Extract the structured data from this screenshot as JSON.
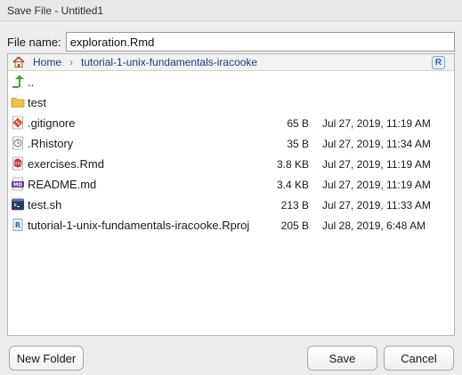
{
  "window": {
    "title": "Save File - Untitled1"
  },
  "filename": {
    "label": "File name:",
    "value": "exploration.Rmd"
  },
  "breadcrumb": {
    "home_label": "Home",
    "path_label": "tutorial-1-unix-fundamentals-iracooke",
    "project_badge": "R"
  },
  "files": [
    {
      "name": "..",
      "size": "",
      "modified": "",
      "icon": "parent-folder-icon"
    },
    {
      "name": "test",
      "size": "",
      "modified": "",
      "icon": "folder-icon"
    },
    {
      "name": ".gitignore",
      "size": "65 B",
      "modified": "Jul 27, 2019, 11:19 AM",
      "icon": "gitignore-icon"
    },
    {
      "name": ".Rhistory",
      "size": "35 B",
      "modified": "Jul 27, 2019, 11:34 AM",
      "icon": "history-icon"
    },
    {
      "name": "exercises.Rmd",
      "size": "3.8 KB",
      "modified": "Jul 27, 2019, 11:19 AM",
      "icon": "rmd-file-icon"
    },
    {
      "name": "README.md",
      "size": "3.4 KB",
      "modified": "Jul 27, 2019, 11:19 AM",
      "icon": "markdown-file-icon"
    },
    {
      "name": "test.sh",
      "size": "213 B",
      "modified": "Jul 27, 2019, 11:33 AM",
      "icon": "shell-script-icon"
    },
    {
      "name": "tutorial-1-unix-fundamentals-iracooke.Rproj",
      "size": "205 B",
      "modified": "Jul 28, 2019, 6:48 AM",
      "icon": "rproj-file-icon"
    }
  ],
  "buttons": {
    "new_folder": "New Folder",
    "save": "Save",
    "cancel": "Cancel"
  },
  "colors": {
    "link": "#1a3c80",
    "folder": "#f0c04a",
    "green_arrow": "#3aa33a",
    "rmd_red": "#c83a3a",
    "markdown_purple": "#6a3aa8"
  }
}
